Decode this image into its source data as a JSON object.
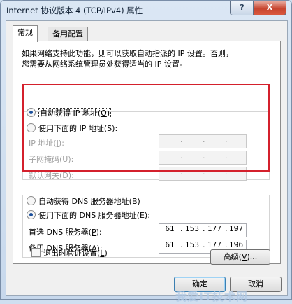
{
  "window": {
    "title": "Internet 协议版本 4 (TCP/IPv4) 属性",
    "help_glyph": "?",
    "close_glyph": "X"
  },
  "tabs": [
    {
      "label": "常规",
      "selected": true
    },
    {
      "label": "备用配置",
      "selected": false
    }
  ],
  "description": {
    "line1": "如果网络支持此功能，则可以获取自动指派的 IP 设置。否则，",
    "line2": "您需要从网络系统管理员处获得适当的 IP 设置。"
  },
  "ip_mode": {
    "auto": {
      "label": "自动获得 IP 地址(",
      "key": "O",
      "close": ")",
      "selected": true
    },
    "manual": {
      "label": "使用下面的 IP 地址(",
      "key": "S",
      "close": "):",
      "selected": false
    },
    "fields": [
      {
        "label": "IP 地址(",
        "key": "I",
        "close": "):",
        "octets": [
          "",
          "",
          "",
          ""
        ]
      },
      {
        "label": "子网掩码(",
        "key": "U",
        "close": "):",
        "octets": [
          "",
          "",
          "",
          ""
        ]
      },
      {
        "label": "默认网关(",
        "key": "D",
        "close": "):",
        "octets": [
          "",
          "",
          "",
          ""
        ]
      }
    ]
  },
  "dns_mode": {
    "auto": {
      "label": "自动获得 DNS 服务器地址(",
      "key": "B",
      "close": ")",
      "selected": false
    },
    "manual": {
      "label": "使用下面的 DNS 服务器地址(",
      "key": "E",
      "close": "):",
      "selected": true
    },
    "preferred": {
      "label": "首选 DNS 服务器(",
      "key": "P",
      "close": "):",
      "octets": [
        "61",
        "153",
        "177",
        "197"
      ]
    },
    "alternate": {
      "label": "备用 DNS 服务器(",
      "key": "A",
      "close": "):",
      "octets": [
        "61",
        "153",
        "177",
        "196"
      ]
    }
  },
  "validate_on_exit": {
    "label": "退出时验证设置(",
    "key": "L",
    "close": ")",
    "checked": false
  },
  "buttons": {
    "advanced": {
      "label": "高级(",
      "key": "V",
      "close": ")..."
    },
    "ok": "确定",
    "cancel": "取消"
  },
  "watermark": "我爱IT技术网",
  "colors": {
    "highlight": "#d4202c",
    "radio_dot": "#1a4f9c",
    "close_button": "#c7452f"
  }
}
